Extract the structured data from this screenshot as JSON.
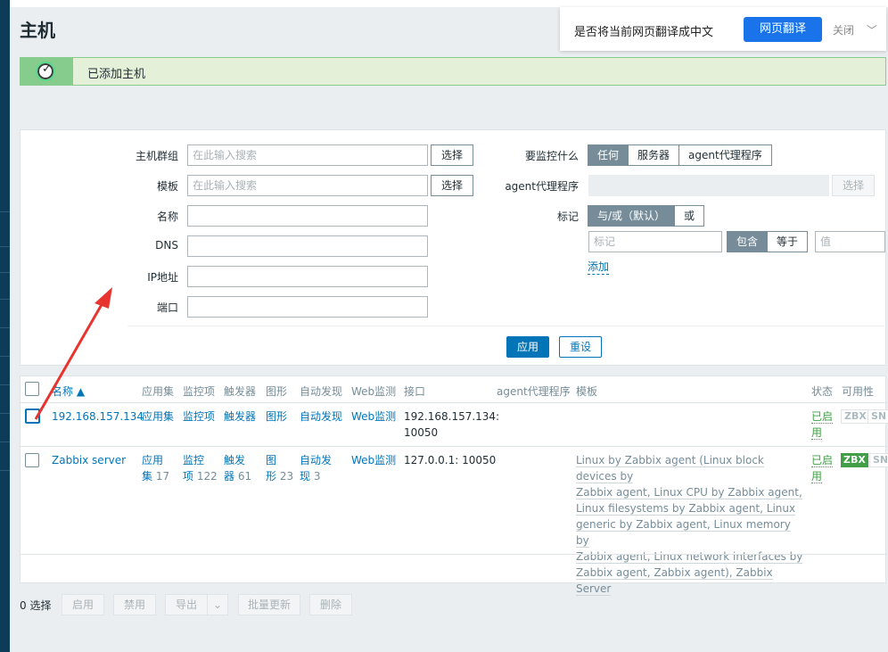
{
  "page": {
    "title": "主机"
  },
  "notice": {
    "message": "已添加主机"
  },
  "translate_bar": {
    "question": "是否将当前网页翻译成中文",
    "translate_button": "网页翻译",
    "close_label": "关闭"
  },
  "filter": {
    "host_groups": {
      "label": "主机群组",
      "placeholder": "在此输入搜索",
      "select": "选择"
    },
    "templates": {
      "label": "模板",
      "placeholder": "在此输入搜索",
      "select": "选择"
    },
    "name": {
      "label": "名称",
      "value": ""
    },
    "dns": {
      "label": "DNS",
      "value": ""
    },
    "ip": {
      "label": "IP地址",
      "value": ""
    },
    "port": {
      "label": "端口",
      "value": ""
    },
    "monitored_by": {
      "label": "要监控什么",
      "options": [
        "任何",
        "服务器",
        "agent代理程序"
      ],
      "selected": "任何"
    },
    "proxy": {
      "label": "agent代理程序",
      "select": "选择"
    },
    "tags": {
      "label": "标记",
      "operator_options": [
        "与/或（默认）",
        "或"
      ],
      "operator_selected": "与/或（默认）",
      "tag_placeholder": "标记",
      "match_options": [
        "包含",
        "等于"
      ],
      "match_selected": "包含",
      "value_placeholder": "值",
      "add_label": "添加"
    },
    "apply": "应用",
    "reset": "重设"
  },
  "table": {
    "columns": [
      "名称 ▲",
      "应用集",
      "监控项",
      "触发器",
      "图形",
      "自动发现",
      "Web监测",
      "接口",
      "agent代理程序",
      "模板",
      "状态",
      "可用性"
    ],
    "rows": [
      {
        "name": "192.168.157.134",
        "applications": "应用集",
        "applications_count": "",
        "items": "监控项",
        "items_count": "",
        "triggers": "触发器",
        "triggers_count": "",
        "graphs": "图形",
        "graphs_count": "",
        "discovery": "自动发现",
        "discovery_count": "",
        "web": "Web监测",
        "interface_line1": "192.168.157.134:",
        "interface_line2": "10050",
        "proxy": "",
        "templates": "",
        "status_line1": "已启",
        "status_line2": "用",
        "availability": [
          "ZBX",
          "SN"
        ]
      },
      {
        "name": "Zabbix server",
        "applications": "应用",
        "applications_tail": "集",
        "applications_count": "17",
        "items": "监控",
        "items_tail": "项",
        "items_count": "122",
        "triggers": "触发",
        "triggers_tail": "器",
        "triggers_count": "61",
        "graphs": "图",
        "graphs_tail": "形",
        "graphs_count": "23",
        "discovery": "自动发",
        "discovery_tail": "现",
        "discovery_count": "3",
        "web": "Web监测",
        "interface_line1": "127.0.0.1: 10050",
        "proxy": "",
        "templates_lines": [
          "Linux by Zabbix agent (Linux block devices by",
          "Zabbix agent, Linux CPU by Zabbix agent,",
          "Linux filesystems by Zabbix agent, Linux",
          "generic by Zabbix agent, Linux memory by",
          "Zabbix agent, Linux network interfaces by",
          "Zabbix agent, Zabbix agent), Zabbix Server"
        ],
        "status_line1": "已启",
        "status_line2": "用",
        "availability": [
          "ZBX",
          "SN"
        ]
      }
    ]
  },
  "bottom_bar": {
    "selected": "0 选择",
    "buttons": [
      "启用",
      "禁用",
      "导出",
      "批量更新",
      "删除"
    ]
  },
  "colors": {
    "accent": "#0275b8",
    "success_bg": "#e5f0d9",
    "success_border": "#86cc8c",
    "annotation_arrow": "#e8342f"
  }
}
